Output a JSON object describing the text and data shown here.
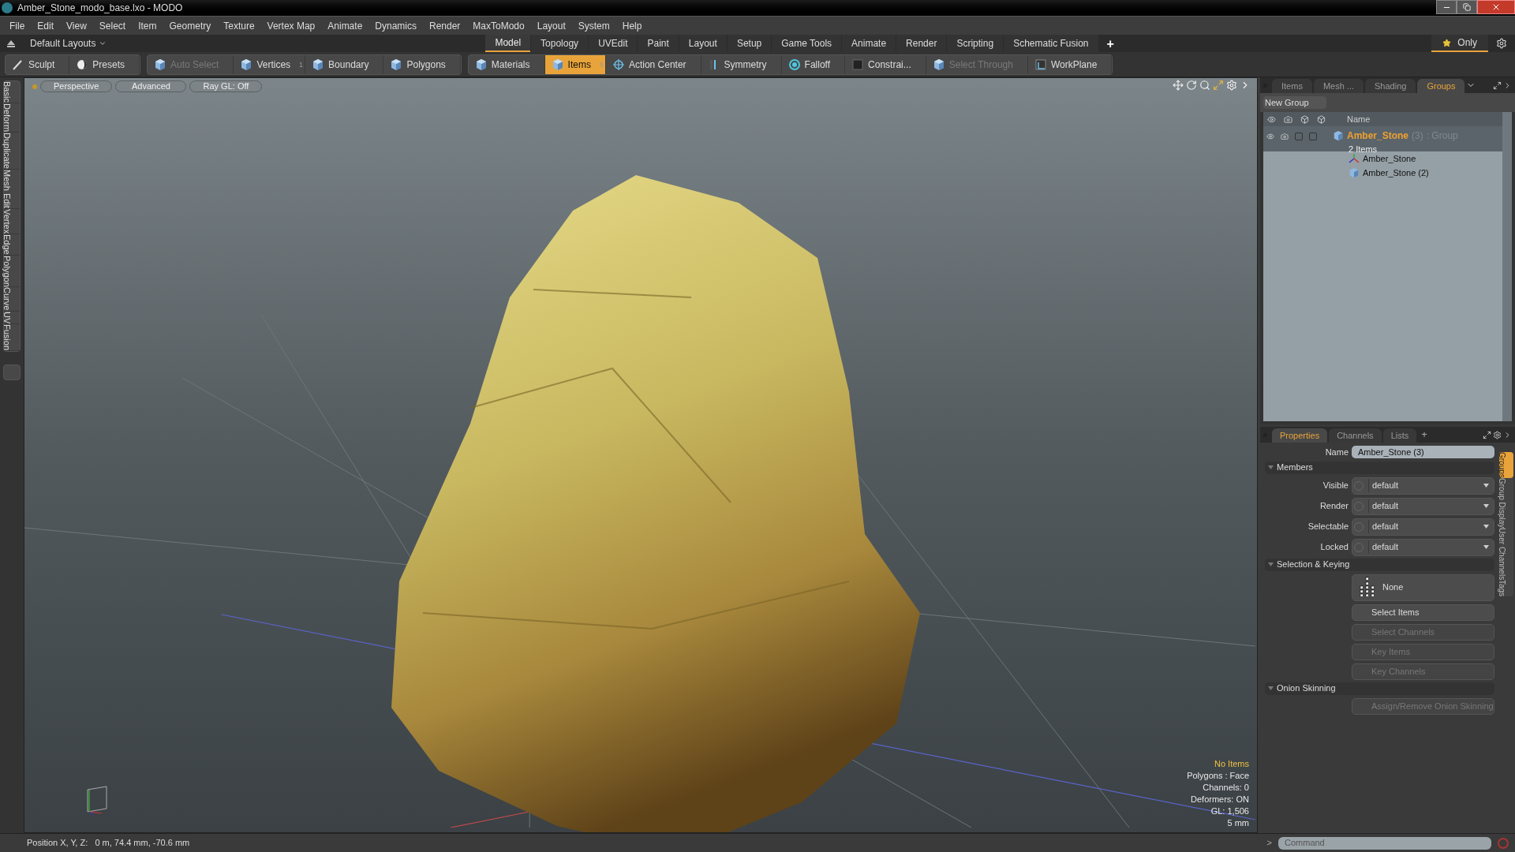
{
  "window": {
    "title": "Amber_Stone_modo_base.lxo - MODO"
  },
  "menu": [
    "File",
    "Edit",
    "View",
    "Select",
    "Item",
    "Geometry",
    "Texture",
    "Vertex Map",
    "Animate",
    "Dynamics",
    "Render",
    "MaxToModo",
    "Layout",
    "System",
    "Help"
  ],
  "layout_bar": {
    "layout_selector": "Default Layouts",
    "tabs": [
      {
        "label": "Model",
        "selected": true
      },
      {
        "label": "Topology",
        "selected": false
      },
      {
        "label": "UVEdit",
        "selected": false
      },
      {
        "label": "Paint",
        "selected": false
      },
      {
        "label": "Layout",
        "selected": false
      },
      {
        "label": "Setup",
        "selected": false
      },
      {
        "label": "Game Tools",
        "selected": false
      },
      {
        "label": "Animate",
        "selected": false
      },
      {
        "label": "Render",
        "selected": false
      },
      {
        "label": "Scripting",
        "selected": false
      },
      {
        "label": "Schematic Fusion",
        "selected": false
      }
    ],
    "add_tab": "+",
    "filter": "Only"
  },
  "toolbar": [
    [
      {
        "label": "Sculpt",
        "selected": false,
        "disabled": false
      },
      {
        "label": "Presets",
        "selected": false,
        "disabled": false
      }
    ],
    [
      {
        "label": "Auto Select",
        "selected": false,
        "disabled": true
      },
      {
        "label": "Vertices",
        "badge": "1",
        "selected": false,
        "disabled": false
      },
      {
        "label": "Boundary",
        "selected": false,
        "disabled": false
      },
      {
        "label": "Polygons",
        "selected": false,
        "disabled": false
      }
    ],
    [
      {
        "label": "Materials",
        "selected": false,
        "disabled": false
      },
      {
        "label": "Items",
        "badge": "5",
        "selected": true,
        "disabled": false
      },
      {
        "label": "Action Center",
        "selected": false,
        "disabled": false
      },
      {
        "label": "Symmetry",
        "selected": false,
        "disabled": false
      },
      {
        "label": "Falloff",
        "selected": false,
        "disabled": false
      },
      {
        "label": "Constrai...",
        "selected": false,
        "disabled": false
      },
      {
        "label": "Select Through",
        "selected": false,
        "disabled": true
      },
      {
        "label": "WorkPlane",
        "selected": false,
        "disabled": false
      }
    ]
  ],
  "left_tabs": [
    "Basic",
    "Deform",
    "Duplicate",
    "Mesh Edit",
    "Vertex",
    "Edge",
    "Polygon",
    "Curve",
    "UV",
    "Fusion"
  ],
  "viewport": {
    "tabs": [
      "Perspective",
      "Advanced",
      "Ray GL: Off"
    ],
    "info": [
      {
        "text": "No Items",
        "highlight": true
      },
      {
        "text": "Polygons : Face",
        "highlight": false
      },
      {
        "text": "Channels: 0",
        "highlight": false
      },
      {
        "text": "Deformers: ON",
        "highlight": false
      },
      {
        "text": "GL: 1,506",
        "highlight": false
      },
      {
        "text": "5 mm",
        "highlight": false
      }
    ]
  },
  "groups_panel": {
    "tabs": [
      {
        "label": "Items",
        "selected": false
      },
      {
        "label": "Mesh ...",
        "selected": false
      },
      {
        "label": "Shading",
        "selected": false
      },
      {
        "label": "Groups",
        "selected": true
      }
    ],
    "new_group": "New Group",
    "column_name": "Name",
    "tree": [
      {
        "name": "Amber_Stone",
        "count": "(3)",
        "type": ": Group",
        "sub": "2 Items",
        "selected": true,
        "children": [
          {
            "name": "Amber_Stone",
            "kind": "locator"
          },
          {
            "name": "Amber_Stone (2)",
            "kind": "mesh"
          }
        ]
      }
    ]
  },
  "properties_panel": {
    "tabs": [
      {
        "label": "Properties",
        "selected": true
      },
      {
        "label": "Channels",
        "selected": false
      },
      {
        "label": "Lists",
        "selected": false
      }
    ],
    "add_tab": "+",
    "name_label": "Name",
    "name_value": "Amber_Stone (3)",
    "sections": [
      {
        "title": "Members",
        "expanded": true,
        "rows": [
          {
            "kind": "dropdown",
            "label": "Visible",
            "value": "default"
          },
          {
            "kind": "dropdown",
            "label": "Render",
            "value": "default"
          },
          {
            "kind": "dropdown",
            "label": "Selectable",
            "value": "default"
          },
          {
            "kind": "dropdown",
            "label": "Locked",
            "value": "default"
          }
        ]
      },
      {
        "title": "Selection & Keying",
        "expanded": true,
        "rows": [
          {
            "kind": "preset",
            "value": "None"
          },
          {
            "kind": "button",
            "value": "Select Items",
            "disabled": false
          },
          {
            "kind": "button",
            "value": "Select Channels",
            "disabled": true
          },
          {
            "kind": "button",
            "value": "Key Items",
            "disabled": true
          },
          {
            "kind": "button",
            "value": "Key Channels",
            "disabled": true
          }
        ]
      },
      {
        "title": "Onion Skinning",
        "expanded": true,
        "rows": [
          {
            "kind": "button",
            "value": "Assign/Remove Onion Skinning",
            "disabled": true
          }
        ]
      }
    ],
    "side_tabs": [
      {
        "label": "Groups",
        "selected": true
      },
      {
        "label": "Group Display",
        "selected": false
      },
      {
        "label": "User Channels",
        "selected": false
      },
      {
        "label": "Tags",
        "selected": false
      }
    ]
  },
  "status_bar": {
    "position": "Position X, Y, Z:   0 m, 74.4 mm, -70.6 mm",
    "command_prompt": ">",
    "command_placeholder": "Command"
  }
}
